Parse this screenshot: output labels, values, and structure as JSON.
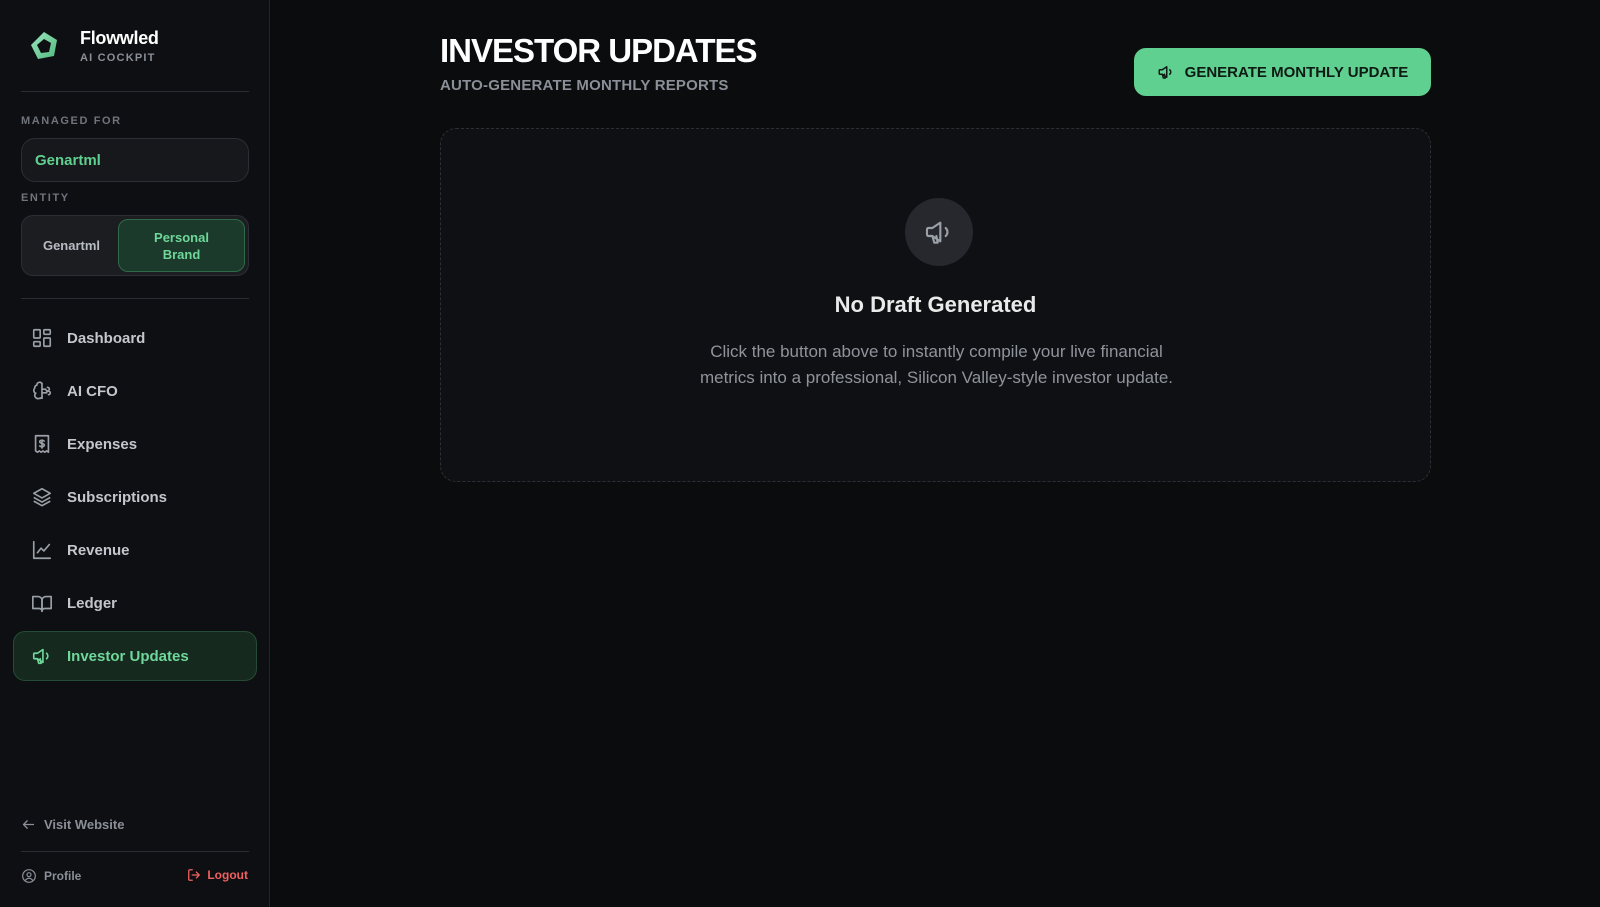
{
  "app": {
    "name": "Flowwled",
    "subtitle": "AI COCKPIT"
  },
  "sidebar": {
    "managed_label": "MANAGED FOR",
    "managed_value": "Genartml",
    "entity_label": "ENTITY",
    "entity_options": [
      {
        "label": "Genartml",
        "active": false
      },
      {
        "label": "Personal Brand",
        "active": true
      }
    ],
    "nav": [
      {
        "label": "Dashboard",
        "icon": "dashboard-icon"
      },
      {
        "label": "AI CFO",
        "icon": "brain-icon"
      },
      {
        "label": "Expenses",
        "icon": "receipt-icon"
      },
      {
        "label": "Subscriptions",
        "icon": "layers-icon"
      },
      {
        "label": "Revenue",
        "icon": "line-chart-icon"
      },
      {
        "label": "Ledger",
        "icon": "book-icon"
      },
      {
        "label": "Investor Updates",
        "icon": "megaphone-icon",
        "active": true
      }
    ],
    "visit_website": "Visit Website",
    "profile": "Profile",
    "logout": "Logout"
  },
  "main": {
    "title": "INVESTOR UPDATES",
    "subtitle": "AUTO-GENERATE MONTHLY REPORTS",
    "generate_button": "GENERATE MONTHLY UPDATE",
    "empty_state": {
      "title": "No Draft Generated",
      "description": "Click the button above to instantly compile your live financial metrics into a professional, Silicon Valley-style investor update."
    }
  },
  "colors": {
    "accent": "#5fd08f",
    "background": "#0b0c0e",
    "danger": "#f06060"
  }
}
